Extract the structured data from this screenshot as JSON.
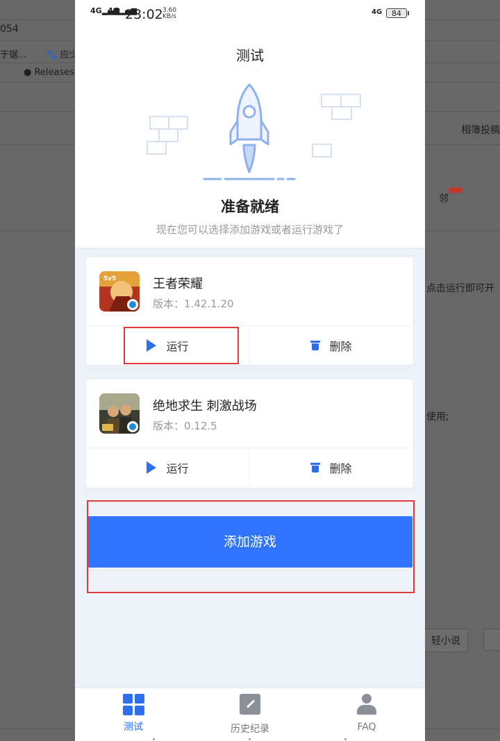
{
  "background": {
    "url_fragment": "054",
    "bookmark_1": "于锯...",
    "bookmark_2": "应少",
    "releases_label": "Releases",
    "right_tab": "相簿投稿",
    "side_text_1": "点击运行即可开",
    "side_text_2": "使用;",
    "pill_label": "轻小说",
    "badge_label": "邻"
  },
  "status_bar": {
    "signal_1": "4G",
    "signal_2": "4G",
    "time": "23:02",
    "speed_value": "3.60",
    "speed_unit": "KB/s",
    "network": "4G",
    "battery": "84"
  },
  "header": {
    "title": "测试",
    "ready_title": "准备就绪",
    "ready_subtitle": "现在您可以选择添加游戏或者运行游戏了"
  },
  "games": [
    {
      "name": "王者荣耀",
      "version": "版本：1.42.1.20",
      "run_label": "运行",
      "delete_label": "删除"
    },
    {
      "name": "绝地求生 刺激战场",
      "version": "版本：0.12.5",
      "run_label": "运行",
      "delete_label": "删除"
    }
  ],
  "add_button": {
    "label": "添加游戏"
  },
  "tabs": [
    {
      "label": "测试",
      "icon": "grid-icon",
      "active": true
    },
    {
      "label": "历史纪录",
      "icon": "edit-icon",
      "active": false
    },
    {
      "label": "FAQ",
      "icon": "user-icon",
      "active": false
    }
  ],
  "colors": {
    "accent": "#2e6ff0",
    "button": "#2e74ff",
    "highlight": "#e03a3a"
  }
}
